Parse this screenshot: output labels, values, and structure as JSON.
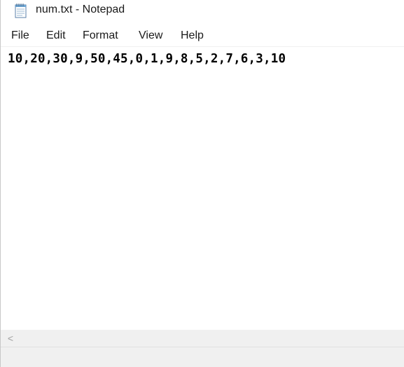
{
  "window": {
    "title": "num.txt - Notepad",
    "app_icon": "notepad-icon"
  },
  "menu": {
    "items": [
      "File",
      "Edit",
      "Format",
      "View",
      "Help"
    ]
  },
  "editor": {
    "content": "10,20,30,9,50,45,0,1,9,8,5,2,7,6,3,10"
  },
  "scrollbar": {
    "left_arrow_icon": "chevron-left-icon",
    "left_arrow_glyph": "<"
  }
}
